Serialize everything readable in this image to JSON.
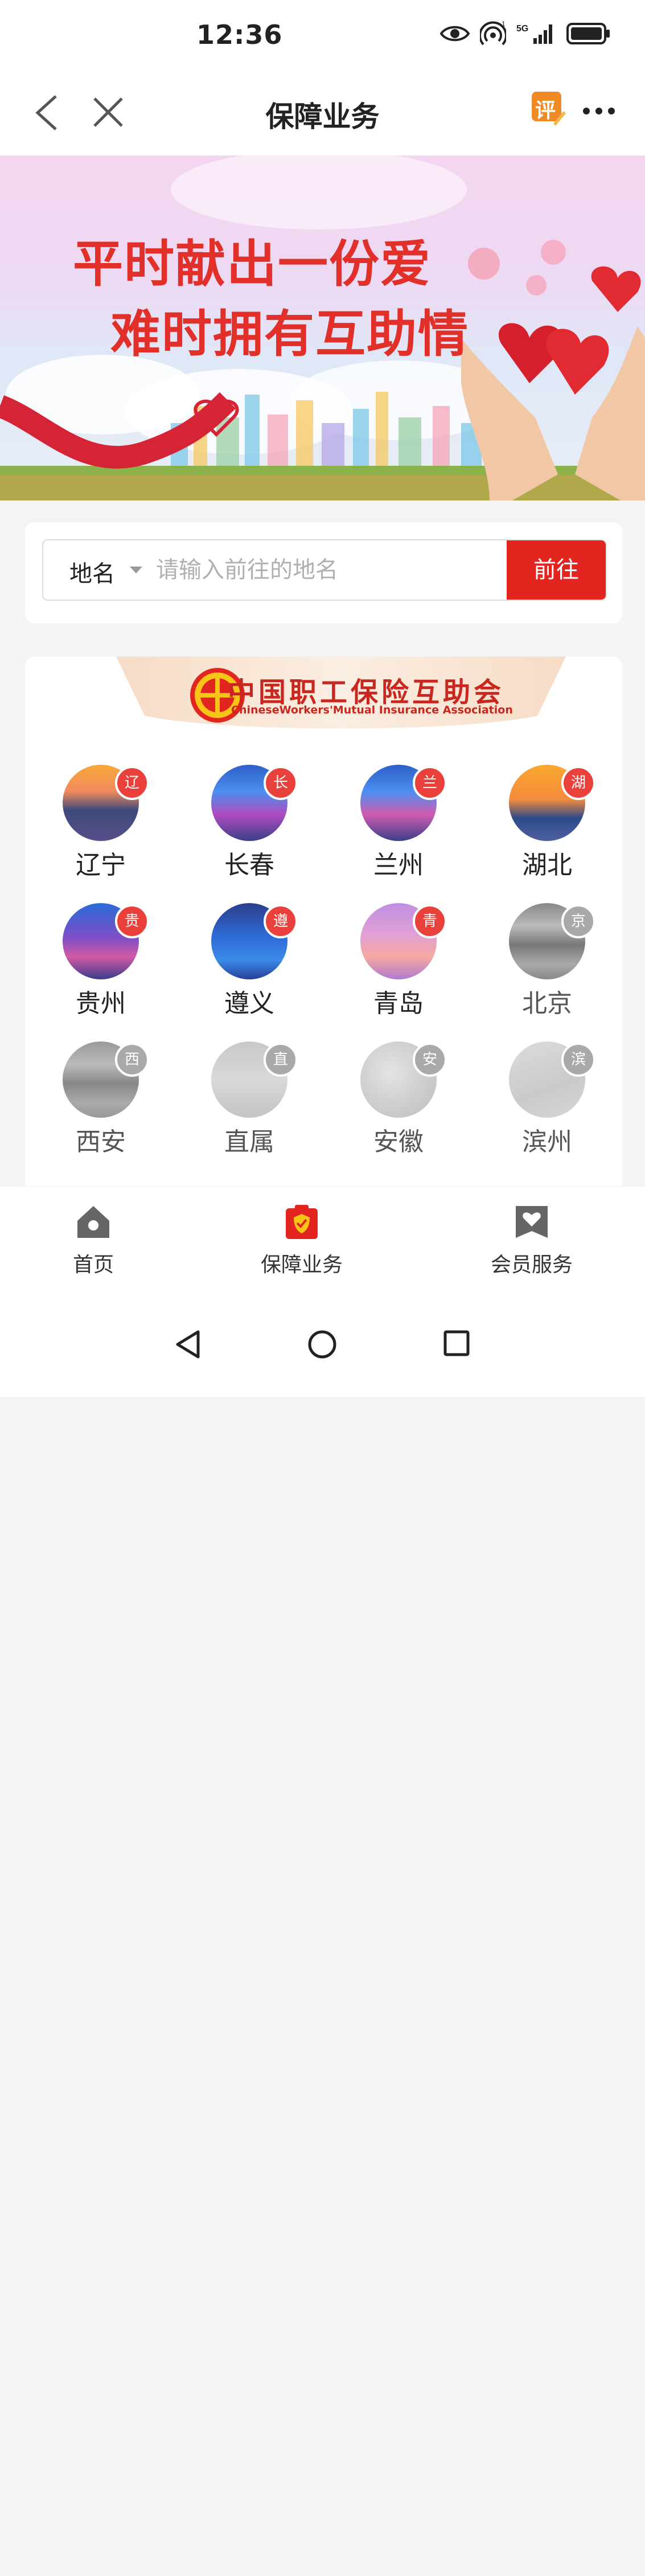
{
  "status_bar": {
    "time": "12:36",
    "network": "5G",
    "icons": [
      "eye-icon",
      "hotspot-icon",
      "signal-icon",
      "battery-icon"
    ]
  },
  "nav": {
    "title": "保障业务",
    "rate_icon_text": "评"
  },
  "banner": {
    "line1": "平时献出一份爱",
    "line2": "难时拥有互助情"
  },
  "search": {
    "place_label": "地名",
    "placeholder": "请输入前往的地名",
    "go_label": "前往"
  },
  "association": {
    "name_cn": "中国职工保险互助会",
    "name_en": "ChineseWorkers'Mutual Insurance Association"
  },
  "regions": [
    {
      "name": "辽宁",
      "badge": "辽",
      "active": true
    },
    {
      "name": "长春",
      "badge": "长",
      "active": true
    },
    {
      "name": "兰州",
      "badge": "兰",
      "active": true
    },
    {
      "name": "湖北",
      "badge": "湖",
      "active": true
    },
    {
      "name": "贵州",
      "badge": "贵",
      "active": true
    },
    {
      "name": "遵义",
      "badge": "遵",
      "active": true
    },
    {
      "name": "青岛",
      "badge": "青",
      "active": true
    },
    {
      "name": "北京",
      "badge": "京",
      "active": false
    },
    {
      "name": "西安",
      "badge": "西",
      "active": false
    },
    {
      "name": "直属",
      "badge": "直",
      "active": false
    },
    {
      "name": "安徽",
      "badge": "安",
      "active": false
    },
    {
      "name": "滨州",
      "badge": "滨",
      "active": false
    }
  ],
  "tabs": [
    {
      "label": "首页"
    },
    {
      "label": "保障业务"
    },
    {
      "label": "会员服务"
    }
  ],
  "colors": {
    "accent": "#e3251f",
    "badge_red": "#e9403b",
    "badge_gray": "#a9a9a9"
  }
}
